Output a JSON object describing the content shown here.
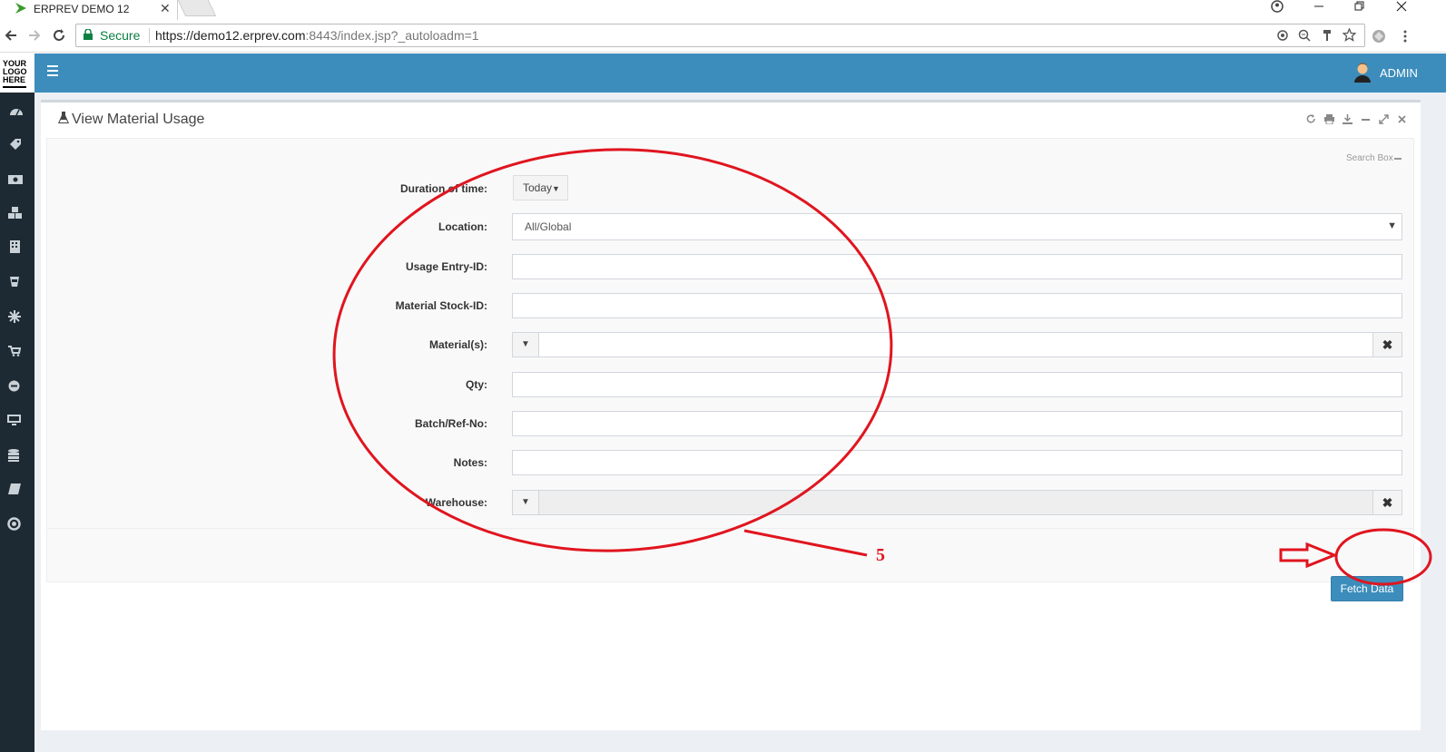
{
  "browser": {
    "tab_title": "ERPREV DEMO 12",
    "tab_close": "✕",
    "secure_label": "Secure",
    "url_base": "https://demo12.erprev.com",
    "url_rest": ":8443/index.jsp?_autoloadm=1"
  },
  "app": {
    "logo_lines": [
      "YOUR",
      "LOGO",
      "HERE"
    ],
    "user": "ADMIN",
    "accent": "#3c8dbc",
    "sidebar_icons": [
      "dashboard-icon",
      "tag-icon",
      "money-icon",
      "cubes-icon",
      "building-icon",
      "cup-icon",
      "snowflake-icon",
      "cart-icon",
      "circle-icon",
      "desktop-icon",
      "database-icon",
      "book-icon",
      "lifebuoy-icon"
    ]
  },
  "page": {
    "title": "View Material Usage",
    "search_box_label": "Search Box",
    "fields": {
      "duration_label": "Duration of time:",
      "duration_value": "Today",
      "location_label": "Location:",
      "location_value": "All/Global",
      "usage_entry_label": "Usage Entry-ID:",
      "material_stock_label": "Material Stock-ID:",
      "materials_label": "Material(s):",
      "qty_label": "Qty:",
      "batch_label": "Batch/Ref-No:",
      "notes_label": "Notes:",
      "warehouse_label": "Warehouse:"
    },
    "fetch_button": "Fetch Data"
  },
  "annotation": {
    "step_number": "5",
    "color": "#e0151f"
  }
}
